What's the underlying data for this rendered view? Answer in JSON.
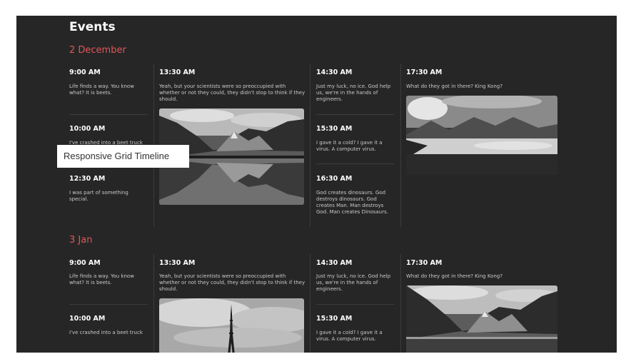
{
  "page_title": "Events",
  "tooltip": "Responsive Grid Timeline",
  "days": [
    {
      "date": "2 December",
      "col1": [
        {
          "time": "9:00 AM",
          "text": "Life finds a way. You know what? It is beets."
        },
        {
          "time": "10:00 AM",
          "text": "I've crashed into a beet truck"
        },
        {
          "time": "12:30 AM",
          "text": "I was part of something special."
        }
      ],
      "col2": {
        "time": "13:30 AM",
        "text": "Yeah, but your scientists were so preoccupied with whether or not they could, they didn't stop to think if they should.",
        "image": "mountain-lake-reflection"
      },
      "col3": [
        {
          "time": "14:30 AM",
          "text": "Just my luck, no ice. God help us, we're in the hands of engineers."
        },
        {
          "time": "15:30 AM",
          "text": "I gave it a cold? I gave it a virus. A computer virus."
        },
        {
          "time": "16:30 AM",
          "text": "God creates dinosaurs. God destroys dinosaurs. God creates Man. Man destroys God. Man creates Dinosaurs."
        }
      ],
      "col4": {
        "time": "17:30 AM",
        "text": "What do they got in there? King Kong?",
        "image": "misty-mountain-valley"
      }
    },
    {
      "date": "3 Jan",
      "col1": [
        {
          "time": "9:00 AM",
          "text": "Life finds a way. You know what? It is beets."
        },
        {
          "time": "10:00 AM",
          "text": "I've crashed into a beet truck"
        }
      ],
      "col2": {
        "time": "13:30 AM",
        "text": "Yeah, but your scientists were so preoccupied with whether or not they could, they didn't stop to think if they should.",
        "image": "eiffel-tower"
      },
      "col3": [
        {
          "time": "14:30 AM",
          "text": "Just my luck, no ice. God help us, we're in the hands of engineers."
        },
        {
          "time": "15:30 AM",
          "text": "I gave it a cold? I gave it a virus. A computer virus."
        }
      ],
      "col4": {
        "time": "17:30 AM",
        "text": "What do they got in there? King Kong?",
        "image": "mountain-lake-reflection"
      }
    }
  ]
}
